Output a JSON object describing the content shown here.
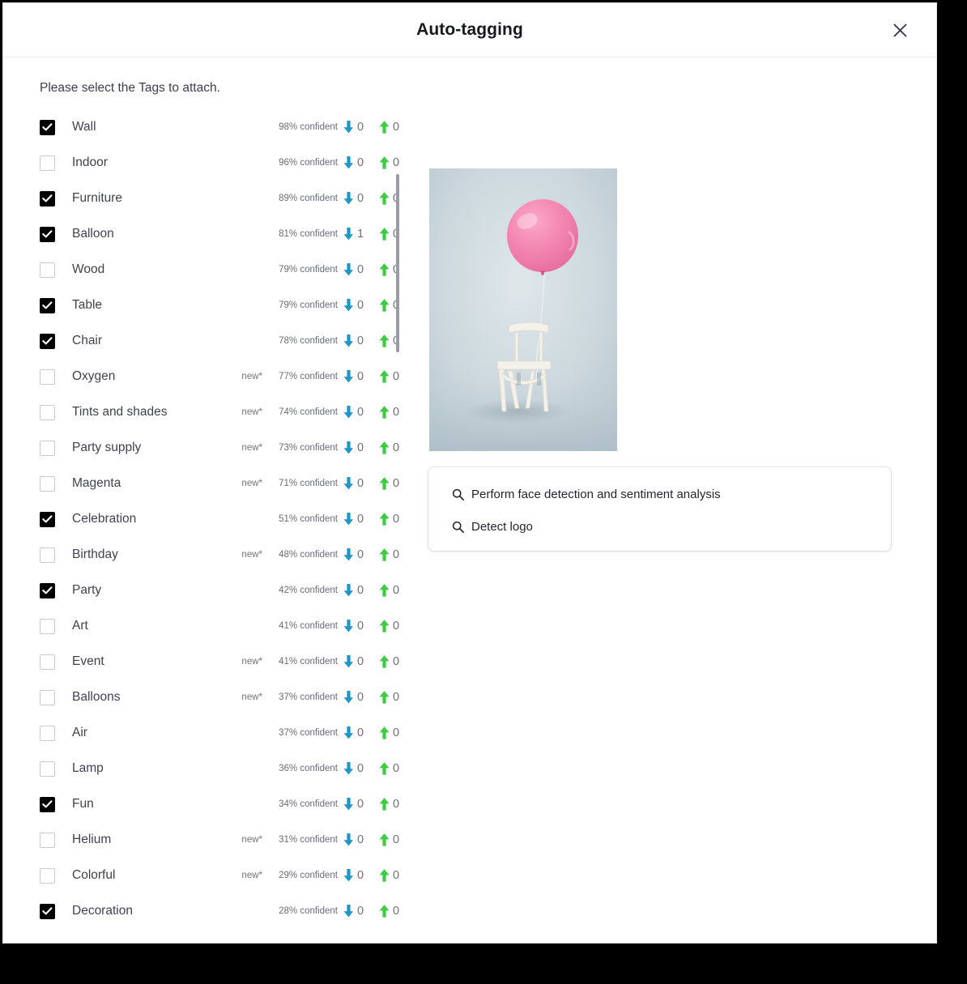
{
  "dialog": {
    "title": "Auto-tagging",
    "close_icon": "close-icon",
    "instruction": "Please select the Tags to attach."
  },
  "tags": {
    "new_badge_label": "new*",
    "confidence_suffix": "% confident",
    "items": [
      {
        "label": "Wall",
        "checked": true,
        "is_new": false,
        "confidence": "98% confident",
        "downvotes": "0",
        "upvotes": "0"
      },
      {
        "label": "Indoor",
        "checked": false,
        "is_new": false,
        "confidence": "96% confident",
        "downvotes": "0",
        "upvotes": "0"
      },
      {
        "label": "Furniture",
        "checked": true,
        "is_new": false,
        "confidence": "89% confident",
        "downvotes": "0",
        "upvotes": "0"
      },
      {
        "label": "Balloon",
        "checked": true,
        "is_new": false,
        "confidence": "81% confident",
        "downvotes": "1",
        "upvotes": "0"
      },
      {
        "label": "Wood",
        "checked": false,
        "is_new": false,
        "confidence": "79% confident",
        "downvotes": "0",
        "upvotes": "0"
      },
      {
        "label": "Table",
        "checked": true,
        "is_new": false,
        "confidence": "79% confident",
        "downvotes": "0",
        "upvotes": "0"
      },
      {
        "label": "Chair",
        "checked": true,
        "is_new": false,
        "confidence": "78% confident",
        "downvotes": "0",
        "upvotes": "0"
      },
      {
        "label": "Oxygen",
        "checked": false,
        "is_new": true,
        "confidence": "77% confident",
        "downvotes": "0",
        "upvotes": "0"
      },
      {
        "label": "Tints and shades",
        "checked": false,
        "is_new": true,
        "confidence": "74% confident",
        "downvotes": "0",
        "upvotes": "0"
      },
      {
        "label": "Party supply",
        "checked": false,
        "is_new": true,
        "confidence": "73% confident",
        "downvotes": "0",
        "upvotes": "0"
      },
      {
        "label": "Magenta",
        "checked": false,
        "is_new": true,
        "confidence": "71% confident",
        "downvotes": "0",
        "upvotes": "0"
      },
      {
        "label": "Celebration",
        "checked": true,
        "is_new": false,
        "confidence": "51% confident",
        "downvotes": "0",
        "upvotes": "0"
      },
      {
        "label": "Birthday",
        "checked": false,
        "is_new": true,
        "confidence": "48% confident",
        "downvotes": "0",
        "upvotes": "0"
      },
      {
        "label": "Party",
        "checked": true,
        "is_new": false,
        "confidence": "42% confident",
        "downvotes": "0",
        "upvotes": "0"
      },
      {
        "label": "Art",
        "checked": false,
        "is_new": false,
        "confidence": "41% confident",
        "downvotes": "0",
        "upvotes": "0"
      },
      {
        "label": "Event",
        "checked": false,
        "is_new": true,
        "confidence": "41% confident",
        "downvotes": "0",
        "upvotes": "0"
      },
      {
        "label": "Balloons",
        "checked": false,
        "is_new": true,
        "confidence": "37% confident",
        "downvotes": "0",
        "upvotes": "0"
      },
      {
        "label": "Air",
        "checked": false,
        "is_new": false,
        "confidence": "37% confident",
        "downvotes": "0",
        "upvotes": "0"
      },
      {
        "label": "Lamp",
        "checked": false,
        "is_new": false,
        "confidence": "36% confident",
        "downvotes": "0",
        "upvotes": "0"
      },
      {
        "label": "Fun",
        "checked": true,
        "is_new": false,
        "confidence": "34% confident",
        "downvotes": "0",
        "upvotes": "0"
      },
      {
        "label": "Helium",
        "checked": false,
        "is_new": true,
        "confidence": "31% confident",
        "downvotes": "0",
        "upvotes": "0"
      },
      {
        "label": "Colorful",
        "checked": false,
        "is_new": true,
        "confidence": "29% confident",
        "downvotes": "0",
        "upvotes": "0"
      },
      {
        "label": "Decoration",
        "checked": true,
        "is_new": false,
        "confidence": "28% confident",
        "downvotes": "0",
        "upvotes": "0"
      }
    ]
  },
  "preview": {
    "alt": "pink balloon tied to a white chair"
  },
  "actions": {
    "items": [
      {
        "label": "Perform face detection and sentiment analysis",
        "icon": "search-icon"
      },
      {
        "label": "Detect logo",
        "icon": "search-icon"
      }
    ]
  },
  "colors": {
    "downvote_arrow": "#1f95c8",
    "upvote_arrow": "#3ecb44",
    "checkbox_checked": "#000000",
    "checkbox_border": "#c8c8dc",
    "title_text": "#18181f",
    "close_icon": "#3f3d56",
    "scrollbar": "#9b9ba6"
  }
}
